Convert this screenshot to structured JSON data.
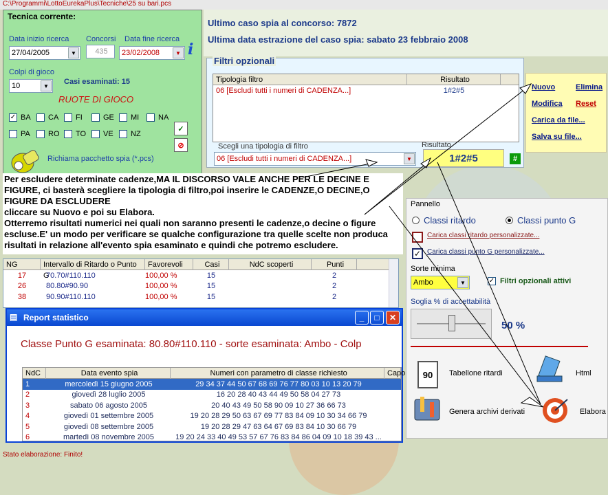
{
  "path": "C:\\Programmi\\LottoEurekaPlus\\Tecniche\\25 su bari.pcs",
  "tecnica": {
    "title": "Tecnica corrente:",
    "data_inizio_label": "Data inizio ricerca",
    "data_inizio": "27/04/2005",
    "concorsi_label": "Concorsi",
    "concorsi": "435",
    "data_fine_label": "Data fine ricerca",
    "data_fine": "23/02/2008",
    "colpi_label": "Colpi di gioco",
    "colpi": "10",
    "casi_esaminati": "Casi esaminati: 15",
    "ruote_title": "RUOTE  DI  GIOCO",
    "ruote": [
      {
        "code": "BA",
        "checked": true
      },
      {
        "code": "CA",
        "checked": false
      },
      {
        "code": "FI",
        "checked": false
      },
      {
        "code": "GE",
        "checked": false
      },
      {
        "code": "MI",
        "checked": false
      },
      {
        "code": "NA",
        "checked": false
      },
      {
        "code": "PA",
        "checked": false
      },
      {
        "code": "RO",
        "checked": false
      },
      {
        "code": "TO",
        "checked": false
      },
      {
        "code": "VE",
        "checked": false
      },
      {
        "code": "NZ",
        "checked": false
      }
    ],
    "richiama": "Richiama pacchetto spia (*.pcs)"
  },
  "info": {
    "ultimo_caso": "Ultimo caso spia al concorso: 7872",
    "ultima_data": "Ultima data estrazione del caso spia: sabato 23 febbraio 2008"
  },
  "filtri": {
    "title": "Filtri opzionali",
    "col_tipologia": "Tipologia filtro",
    "col_risultato": "Risultato",
    "rows": [
      {
        "tipologia": "06 [Escludi tutti i numeri di CADENZA...]",
        "risultato": "1#2#5"
      }
    ],
    "scegli_label": "Scegli una tipologia di filtro",
    "scegli_value": "06 [Escludi tutti i numeri di CADENZA...]",
    "risultato_label": "Risultato",
    "risultato_value": "1#2#5",
    "hash_btn": "#"
  },
  "actions": {
    "nuovo": "Nuovo",
    "elimina": "Elimina",
    "modifica": "Modifica",
    "reset": "Reset",
    "carica": "Carica da file...",
    "salva": "Salva su file..."
  },
  "annotation": [
    "Per escludere determinate cadenze,MA IL DISCORSO VALE ANCHE PER LE DECINE E",
    "FIGURE, ci basterà scegliere la tipologia di filtro,poi inserire le CADENZE,O DECINE,O",
    "FIGURE DA ESCLUDERE",
    "cliccare su Nuovo e poi su Elabora.",
    "Otterremo risultati numerici nei quali non saranno presenti le cadenze,o decine o figure",
    "escluse.E' un modo per verificare se qualche configurazione tra quelle scelte non produca",
    "risultati in relazione all'evento spia esaminato e quindi che potremo escludere."
  ],
  "pannello": {
    "title": "Pannello",
    "classi_ritardo": "Classi ritardo",
    "classi_punto_g": "Classi punto G",
    "carica_ritardo": "Carica classi ritardo personalizzate...",
    "carica_punto_g": "Carica classi punto G personalizzate...",
    "sorte_label": "Sorte minima",
    "sorte_value": "Ambo",
    "filtri_attivi": "Filtri opzionali attivi",
    "soglia_label": "Soglia % di accettabilità",
    "soglia_value": "50 %",
    "slider_level": 0.5,
    "tabellone": "Tabellone ritardi",
    "tabellone_num": "90",
    "html": "Html",
    "genera": "Genera archivi derivati",
    "elabora": "Elabora"
  },
  "ng_table": {
    "headers": [
      "NG",
      "Intervallo di Ritardo o Punto G",
      "Favorevoli",
      "Casi",
      "NdC scoperti",
      "Punti"
    ],
    "rows": [
      [
        "17",
        "70.70#110.110",
        "100,00 %",
        "15",
        "",
        "2"
      ],
      [
        "26",
        "80.80#90.90",
        "100,00 %",
        "15",
        "",
        "2"
      ],
      [
        "38",
        "90.90#110.110",
        "100,00 %",
        "15",
        "",
        "2"
      ]
    ]
  },
  "report": {
    "title": "Report statistico",
    "heading": "Classe Punto G esaminata: 80.80#110.110 - sorte esaminata: Ambo - Colp",
    "headers": [
      "NdC",
      "Data evento spia",
      "Numeri con parametro di classe richiesto",
      "Capo"
    ],
    "rows": [
      [
        "1",
        "mercoledì 15 giugno 2005",
        "29 34 37 44 50 67 68 69 76 77 80 03 10 13 20 79"
      ],
      [
        "2",
        "giovedì 28 luglio 2005",
        "16 20 28 40 43 44 49 50 58 04 27 73"
      ],
      [
        "3",
        "sabato 06 agosto 2005",
        "20 40 43 49 50 58 90 09 10 27 36 66 73"
      ],
      [
        "4",
        "giovedì 01 settembre 2005",
        "19 20 28 29 50 63 67 69 77 83 84 09 10 30 34 66 79"
      ],
      [
        "5",
        "giovedì 08 settembre 2005",
        "19 20 28 29 47 63 64 67 69 83 84 10 30 66 79"
      ],
      [
        "6",
        "martedì 08 novembre 2005",
        "19 20 24 33 40 49 53 57 67 76 83 84 86 04 09 10 18 39 43 ..."
      ]
    ]
  },
  "status": "Stato elaborazione: Finito!",
  "colors": {
    "green_panel": "#9fe39f",
    "yellow_actions": "#fffcb4",
    "accent_blue": "#0842d8",
    "red_text": "#cc1111"
  }
}
